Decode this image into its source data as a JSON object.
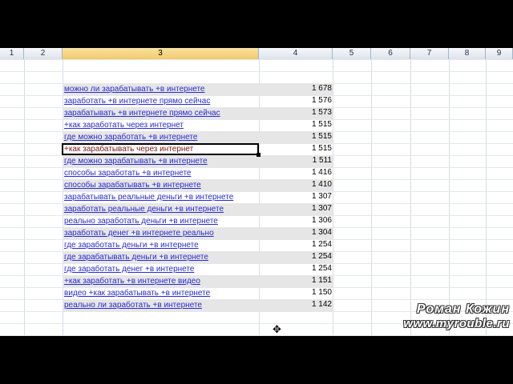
{
  "columns": [
    "1",
    "2",
    "3",
    "4",
    "5",
    "6",
    "7",
    "8",
    "9"
  ],
  "selected_column": "3",
  "rows": [
    {
      "keyword": "можно ли зарабатывать +в интернете",
      "value": "1 678"
    },
    {
      "keyword": "заработать +в интернете прямо сейчас",
      "value": "1 576"
    },
    {
      "keyword": "зарабатывать +в интернете прямо сейчас",
      "value": "1 573"
    },
    {
      "keyword": "+как заработать через интернет",
      "value": "1 515"
    },
    {
      "keyword": "где можно заработать +в интернете",
      "value": "1 515"
    },
    {
      "keyword": "+как зарабатывать через интернет",
      "value": "1 515"
    },
    {
      "keyword": "где можно зарабатывать +в интернете",
      "value": "1 511"
    },
    {
      "keyword": "способы заработать +в интернете",
      "value": "1 416"
    },
    {
      "keyword": "способы зарабатывать +в интернете",
      "value": "1 410"
    },
    {
      "keyword": "зарабатывать реальные деньги +в интернете",
      "value": "1 307"
    },
    {
      "keyword": "заработать реальные деньги +в интернете",
      "value": "1 307"
    },
    {
      "keyword": "реально заработать деньги +в интернете",
      "value": "1 306"
    },
    {
      "keyword": "заработать денег +в интернете реально",
      "value": "1 304"
    },
    {
      "keyword": "где заработать деньги +в интернете",
      "value": "1 254"
    },
    {
      "keyword": "где зарабатывать деньги +в интернете",
      "value": "1 254"
    },
    {
      "keyword": "где заработать денег +в интернете",
      "value": "1 254"
    },
    {
      "keyword": "+как заработать +в интернете видео",
      "value": "1 151"
    },
    {
      "keyword": "видео +как зарабатывать +в интернете",
      "value": "1 150"
    },
    {
      "keyword": "реально ли заработать +в интернете",
      "value": "1 142"
    }
  ],
  "active_row_index": 5,
  "watermark": {
    "line1": "Роман Кожин",
    "line2": "www.myrouble.ru"
  }
}
